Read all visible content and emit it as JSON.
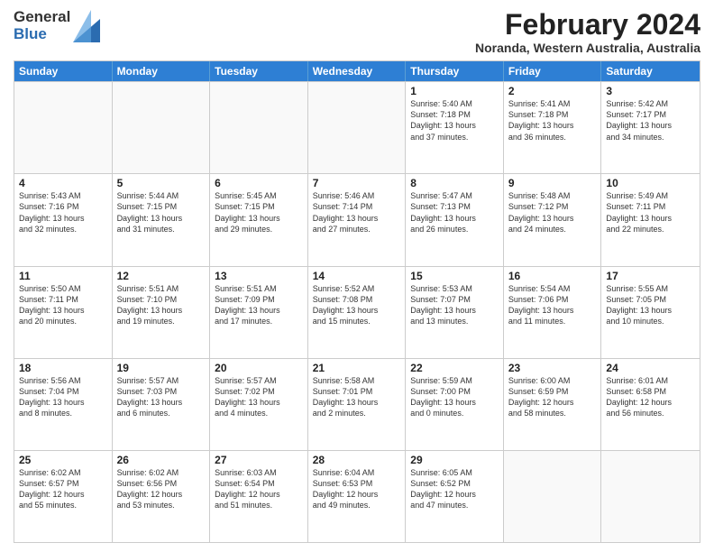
{
  "logo": {
    "general": "General",
    "blue": "Blue"
  },
  "title": {
    "month_year": "February 2024",
    "location": "Noranda, Western Australia, Australia"
  },
  "headers": [
    "Sunday",
    "Monday",
    "Tuesday",
    "Wednesday",
    "Thursday",
    "Friday",
    "Saturday"
  ],
  "weeks": [
    [
      {
        "day": "",
        "info": ""
      },
      {
        "day": "",
        "info": ""
      },
      {
        "day": "",
        "info": ""
      },
      {
        "day": "",
        "info": ""
      },
      {
        "day": "1",
        "info": "Sunrise: 5:40 AM\nSunset: 7:18 PM\nDaylight: 13 hours\nand 37 minutes."
      },
      {
        "day": "2",
        "info": "Sunrise: 5:41 AM\nSunset: 7:18 PM\nDaylight: 13 hours\nand 36 minutes."
      },
      {
        "day": "3",
        "info": "Sunrise: 5:42 AM\nSunset: 7:17 PM\nDaylight: 13 hours\nand 34 minutes."
      }
    ],
    [
      {
        "day": "4",
        "info": "Sunrise: 5:43 AM\nSunset: 7:16 PM\nDaylight: 13 hours\nand 32 minutes."
      },
      {
        "day": "5",
        "info": "Sunrise: 5:44 AM\nSunset: 7:15 PM\nDaylight: 13 hours\nand 31 minutes."
      },
      {
        "day": "6",
        "info": "Sunrise: 5:45 AM\nSunset: 7:15 PM\nDaylight: 13 hours\nand 29 minutes."
      },
      {
        "day": "7",
        "info": "Sunrise: 5:46 AM\nSunset: 7:14 PM\nDaylight: 13 hours\nand 27 minutes."
      },
      {
        "day": "8",
        "info": "Sunrise: 5:47 AM\nSunset: 7:13 PM\nDaylight: 13 hours\nand 26 minutes."
      },
      {
        "day": "9",
        "info": "Sunrise: 5:48 AM\nSunset: 7:12 PM\nDaylight: 13 hours\nand 24 minutes."
      },
      {
        "day": "10",
        "info": "Sunrise: 5:49 AM\nSunset: 7:11 PM\nDaylight: 13 hours\nand 22 minutes."
      }
    ],
    [
      {
        "day": "11",
        "info": "Sunrise: 5:50 AM\nSunset: 7:11 PM\nDaylight: 13 hours\nand 20 minutes."
      },
      {
        "day": "12",
        "info": "Sunrise: 5:51 AM\nSunset: 7:10 PM\nDaylight: 13 hours\nand 19 minutes."
      },
      {
        "day": "13",
        "info": "Sunrise: 5:51 AM\nSunset: 7:09 PM\nDaylight: 13 hours\nand 17 minutes."
      },
      {
        "day": "14",
        "info": "Sunrise: 5:52 AM\nSunset: 7:08 PM\nDaylight: 13 hours\nand 15 minutes."
      },
      {
        "day": "15",
        "info": "Sunrise: 5:53 AM\nSunset: 7:07 PM\nDaylight: 13 hours\nand 13 minutes."
      },
      {
        "day": "16",
        "info": "Sunrise: 5:54 AM\nSunset: 7:06 PM\nDaylight: 13 hours\nand 11 minutes."
      },
      {
        "day": "17",
        "info": "Sunrise: 5:55 AM\nSunset: 7:05 PM\nDaylight: 13 hours\nand 10 minutes."
      }
    ],
    [
      {
        "day": "18",
        "info": "Sunrise: 5:56 AM\nSunset: 7:04 PM\nDaylight: 13 hours\nand 8 minutes."
      },
      {
        "day": "19",
        "info": "Sunrise: 5:57 AM\nSunset: 7:03 PM\nDaylight: 13 hours\nand 6 minutes."
      },
      {
        "day": "20",
        "info": "Sunrise: 5:57 AM\nSunset: 7:02 PM\nDaylight: 13 hours\nand 4 minutes."
      },
      {
        "day": "21",
        "info": "Sunrise: 5:58 AM\nSunset: 7:01 PM\nDaylight: 13 hours\nand 2 minutes."
      },
      {
        "day": "22",
        "info": "Sunrise: 5:59 AM\nSunset: 7:00 PM\nDaylight: 13 hours\nand 0 minutes."
      },
      {
        "day": "23",
        "info": "Sunrise: 6:00 AM\nSunset: 6:59 PM\nDaylight: 12 hours\nand 58 minutes."
      },
      {
        "day": "24",
        "info": "Sunrise: 6:01 AM\nSunset: 6:58 PM\nDaylight: 12 hours\nand 56 minutes."
      }
    ],
    [
      {
        "day": "25",
        "info": "Sunrise: 6:02 AM\nSunset: 6:57 PM\nDaylight: 12 hours\nand 55 minutes."
      },
      {
        "day": "26",
        "info": "Sunrise: 6:02 AM\nSunset: 6:56 PM\nDaylight: 12 hours\nand 53 minutes."
      },
      {
        "day": "27",
        "info": "Sunrise: 6:03 AM\nSunset: 6:54 PM\nDaylight: 12 hours\nand 51 minutes."
      },
      {
        "day": "28",
        "info": "Sunrise: 6:04 AM\nSunset: 6:53 PM\nDaylight: 12 hours\nand 49 minutes."
      },
      {
        "day": "29",
        "info": "Sunrise: 6:05 AM\nSunset: 6:52 PM\nDaylight: 12 hours\nand 47 minutes."
      },
      {
        "day": "",
        "info": ""
      },
      {
        "day": "",
        "info": ""
      }
    ]
  ]
}
